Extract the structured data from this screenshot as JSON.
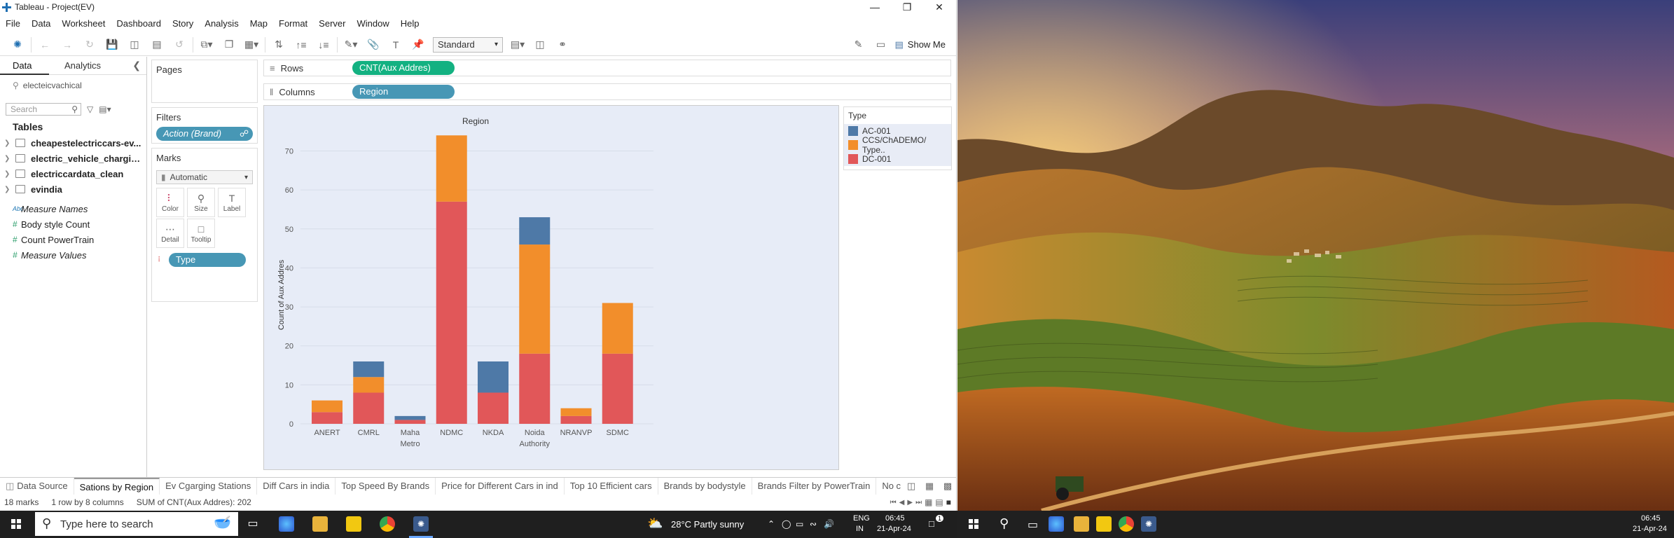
{
  "window": {
    "title": "Tableau - Project(EV)"
  },
  "menu": [
    "File",
    "Data",
    "Worksheet",
    "Dashboard",
    "Story",
    "Analysis",
    "Map",
    "Format",
    "Server",
    "Window",
    "Help"
  ],
  "toolbar": {
    "mark_fit": "Standard",
    "show_me": "Show Me"
  },
  "data_pane": {
    "tabs": [
      "Data",
      "Analytics"
    ],
    "datasource": "electeicvachical",
    "search_placeholder": "Search",
    "tables_header": "Tables",
    "tables": [
      "cheapestelectriccars-ev...",
      "electric_vehicle_chargin...",
      "electriccardata_clean",
      "evindia"
    ],
    "measures": [
      "Measure Names",
      "Body style Count",
      "Count PowerTrain",
      "Measure Values"
    ]
  },
  "cards": {
    "pages": "Pages",
    "filters": "Filters",
    "filter_pill": "Action (Brand)",
    "marks": "Marks",
    "mark_type": "Automatic",
    "mark_buttons": [
      "Color",
      "Size",
      "Label",
      "Detail",
      "Tooltip"
    ],
    "type_pill": "Type"
  },
  "shelves": {
    "rows_label": "Rows",
    "rows_pill": "CNT(Aux Addres)",
    "cols_label": "Columns",
    "cols_pill": "Region"
  },
  "legend": {
    "title": "Type",
    "items": [
      {
        "label": "AC-001",
        "color": "#4e79a7"
      },
      {
        "label": "CCS/ChADEMO/ Type..",
        "color": "#f28e2b"
      },
      {
        "label": "DC-001",
        "color": "#e15759"
      }
    ]
  },
  "chart_data": {
    "type": "bar",
    "stacked": true,
    "title": "Region",
    "ylabel": "Count of Aux Addres",
    "ylim": [
      0,
      78
    ],
    "yticks": [
      0,
      10,
      20,
      30,
      40,
      50,
      60,
      70
    ],
    "categories": [
      "ANERT",
      "CMRL",
      "Maha\nMetro",
      "NDMC",
      "NKDA",
      "Noida\nAuthority",
      "NRANVP",
      "SDMC"
    ],
    "series": [
      {
        "name": "DC-001",
        "color": "#e15759",
        "values": [
          3,
          8,
          1,
          57,
          8,
          18,
          2,
          18
        ]
      },
      {
        "name": "CCS/ChADEMO/ Type..",
        "color": "#f28e2b",
        "values": [
          3,
          4,
          0,
          17,
          0,
          28,
          2,
          13
        ]
      },
      {
        "name": "AC-001",
        "color": "#4e79a7",
        "values": [
          0,
          4,
          1,
          0,
          8,
          7,
          0,
          0
        ]
      }
    ]
  },
  "sheet_tabs": [
    "Data Source",
    "Sations by Region",
    "Ev Cgarging Stations",
    "Diff Cars in india",
    "Top Speed By Brands",
    "Price for Different Cars in ind",
    "Top 10 Efficient  cars",
    "Brands by bodystyle",
    "Brands Filter by PowerTrain",
    "No c"
  ],
  "status": {
    "marks": "18 marks",
    "layout": "1 row by 8 columns",
    "sum": "SUM of CNT(Aux Addres): 202"
  },
  "taskbar": {
    "search_placeholder": "Type here to search",
    "weather": "28°C  Partly sunny",
    "lang": "ENG",
    "region": "IN",
    "time": "06:45",
    "date": "21-Apr-24",
    "notif": "1",
    "time2": "06:45",
    "date2": "21-Apr-24"
  }
}
